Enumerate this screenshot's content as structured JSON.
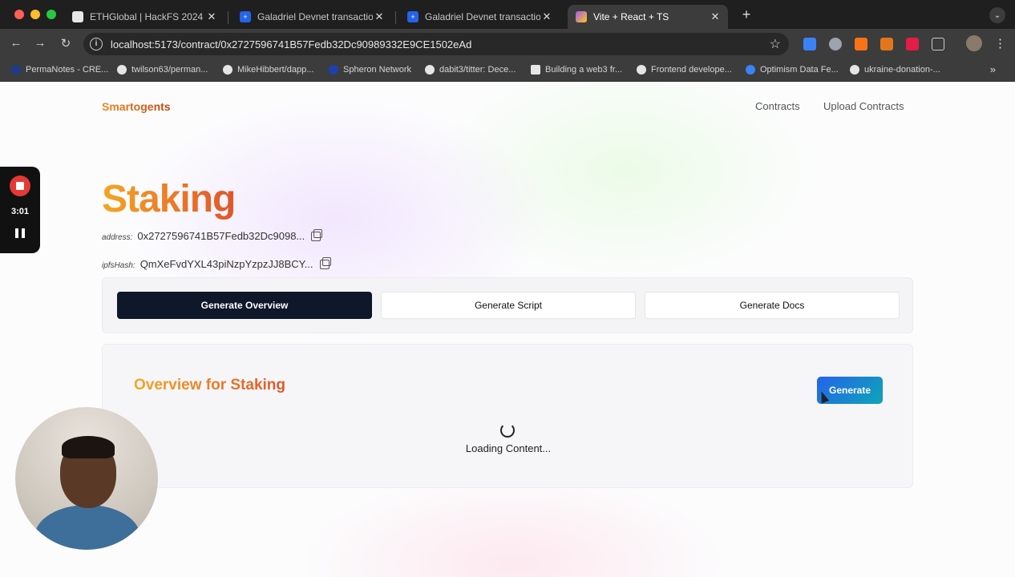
{
  "browser": {
    "tabs": [
      {
        "title": "ETHGlobal | HackFS 2024",
        "active": false,
        "icon": "ethglobal-icon",
        "color": "#e8e8e8"
      },
      {
        "title": "Galadriel Devnet transaction",
        "active": false,
        "icon": "galadriel-icon",
        "color": "#2563eb"
      },
      {
        "title": "Galadriel Devnet transaction",
        "active": false,
        "icon": "galadriel-icon",
        "color": "#2563eb"
      },
      {
        "title": "Vite + React + TS",
        "active": true,
        "icon": "vite-icon",
        "color": "#a855f7"
      }
    ],
    "url": "localhost:5173/contract/0x2727596741B57Fedb32Dc90989332E9CE1502eAd",
    "bookmarks": [
      {
        "label": "PermaNotes - CRE...",
        "color": "#1e3a8a"
      },
      {
        "label": "twilson63/perman...",
        "color": "#e5e5e5"
      },
      {
        "label": "MikeHibbert/dapp...",
        "color": "#e5e5e5"
      },
      {
        "label": "Spheron Network",
        "color": "#1e40af"
      },
      {
        "label": "dabit3/titter: Dece...",
        "color": "#e5e5e5"
      },
      {
        "label": "Building a web3 fr...",
        "color": "#e5e5e5"
      },
      {
        "label": "Frontend develope...",
        "color": "#e5e5e5"
      },
      {
        "label": "Optimism Data Fe...",
        "color": "#3b82f6"
      },
      {
        "label": "ukraine-donation-...",
        "color": "#e5e5e5"
      }
    ]
  },
  "app": {
    "brand": "Smartogents",
    "nav": [
      "Contracts",
      "Upload Contracts"
    ],
    "title": "Staking",
    "address_label": "address:",
    "address_value": "0x2727596741B57Fedb32Dc9098...",
    "ipfs_label": "ipfsHash:",
    "ipfs_value": "QmXeFvdYXL43piNzpYzpzJJ8BCY...",
    "buttons": [
      "Generate Overview",
      "Generate Script",
      "Generate Docs"
    ],
    "panel_title": "Overview for Staking",
    "generate_label": "Generate",
    "loading_text": "Loading Content..."
  },
  "recorder": {
    "time": "3:01"
  }
}
